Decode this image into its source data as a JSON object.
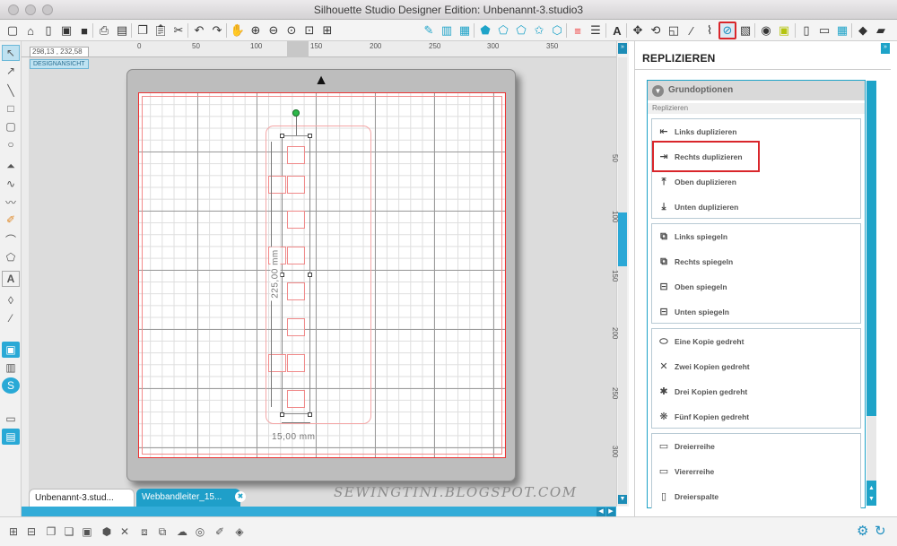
{
  "window": {
    "title": "Silhouette Studio Designer Edition: Unbenannt-3.studio3"
  },
  "toolbar": {
    "icons": [
      "new-file-icon",
      "open-file-icon",
      "phone-icon",
      "save-icon",
      "save-library-icon",
      "print-icon",
      "send-cut-icon",
      "copy-icon",
      "paste-icon",
      "cut-icon",
      "undo-icon",
      "redo-icon",
      "pan-icon",
      "zoom-in-icon",
      "zoom-out-icon",
      "zoom-select-icon",
      "fit-page-icon",
      "line-style-icon",
      "fill-icon",
      "gradient-icon",
      "pattern-icon",
      "shape-fill-icon",
      "shape-icon",
      "star-icon",
      "star-outline-icon",
      "line-color-icon",
      "line-width-icon",
      "text-icon",
      "align-icon",
      "rotate-icon",
      "scale-icon",
      "pen-icon",
      "replicate-icon",
      "modify-icon",
      "library-icon",
      "store-icon",
      "page-setup-icon",
      "cut-settings-icon",
      "eraser-icon",
      "send-icon"
    ]
  },
  "ruler": {
    "coordinates": "298,13 , 232,58",
    "h_ticks": [
      "0",
      "50",
      "100",
      "150",
      "200",
      "250",
      "300",
      "350"
    ],
    "v_ticks": [
      "50",
      "100",
      "150",
      "200",
      "250",
      "300"
    ]
  },
  "canvas": {
    "view_label": "DESIGNANSICHT",
    "height_dimension": "225,00 mm",
    "width_dimension": "15,00 mm"
  },
  "tabs": [
    {
      "label": "Unbenannt-3.stud..."
    },
    {
      "label": "Webbandleiter_15..."
    }
  ],
  "watermark": "SEWINGTINI.BLOGSPOT.COM",
  "panel": {
    "title": "REPLIZIEREN",
    "section": "Grundoptionen",
    "subsection": "Replizieren",
    "groups": [
      {
        "items": [
          "Links duplizieren",
          "Rechts duplizieren",
          "Oben duplizieren",
          "Unten duplizieren"
        ]
      },
      {
        "items": [
          "Links spiegeln",
          "Rechts spiegeln",
          "Oben spiegeln",
          "Unten spiegeln"
        ]
      },
      {
        "items": [
          "Eine Kopie gedreht",
          "Zwei Kopien gedreht",
          "Drei Kopien gedreht",
          "Fünf Kopien gedreht"
        ]
      },
      {
        "items": [
          "Dreierreihe",
          "Viererreihe",
          "Dreierspalte"
        ]
      }
    ],
    "highlighted_item": "Rechts duplizieren"
  },
  "colors": {
    "accent": "#1ea3c8",
    "highlight": "#d9262b",
    "selection_handle": "#2db84a"
  }
}
